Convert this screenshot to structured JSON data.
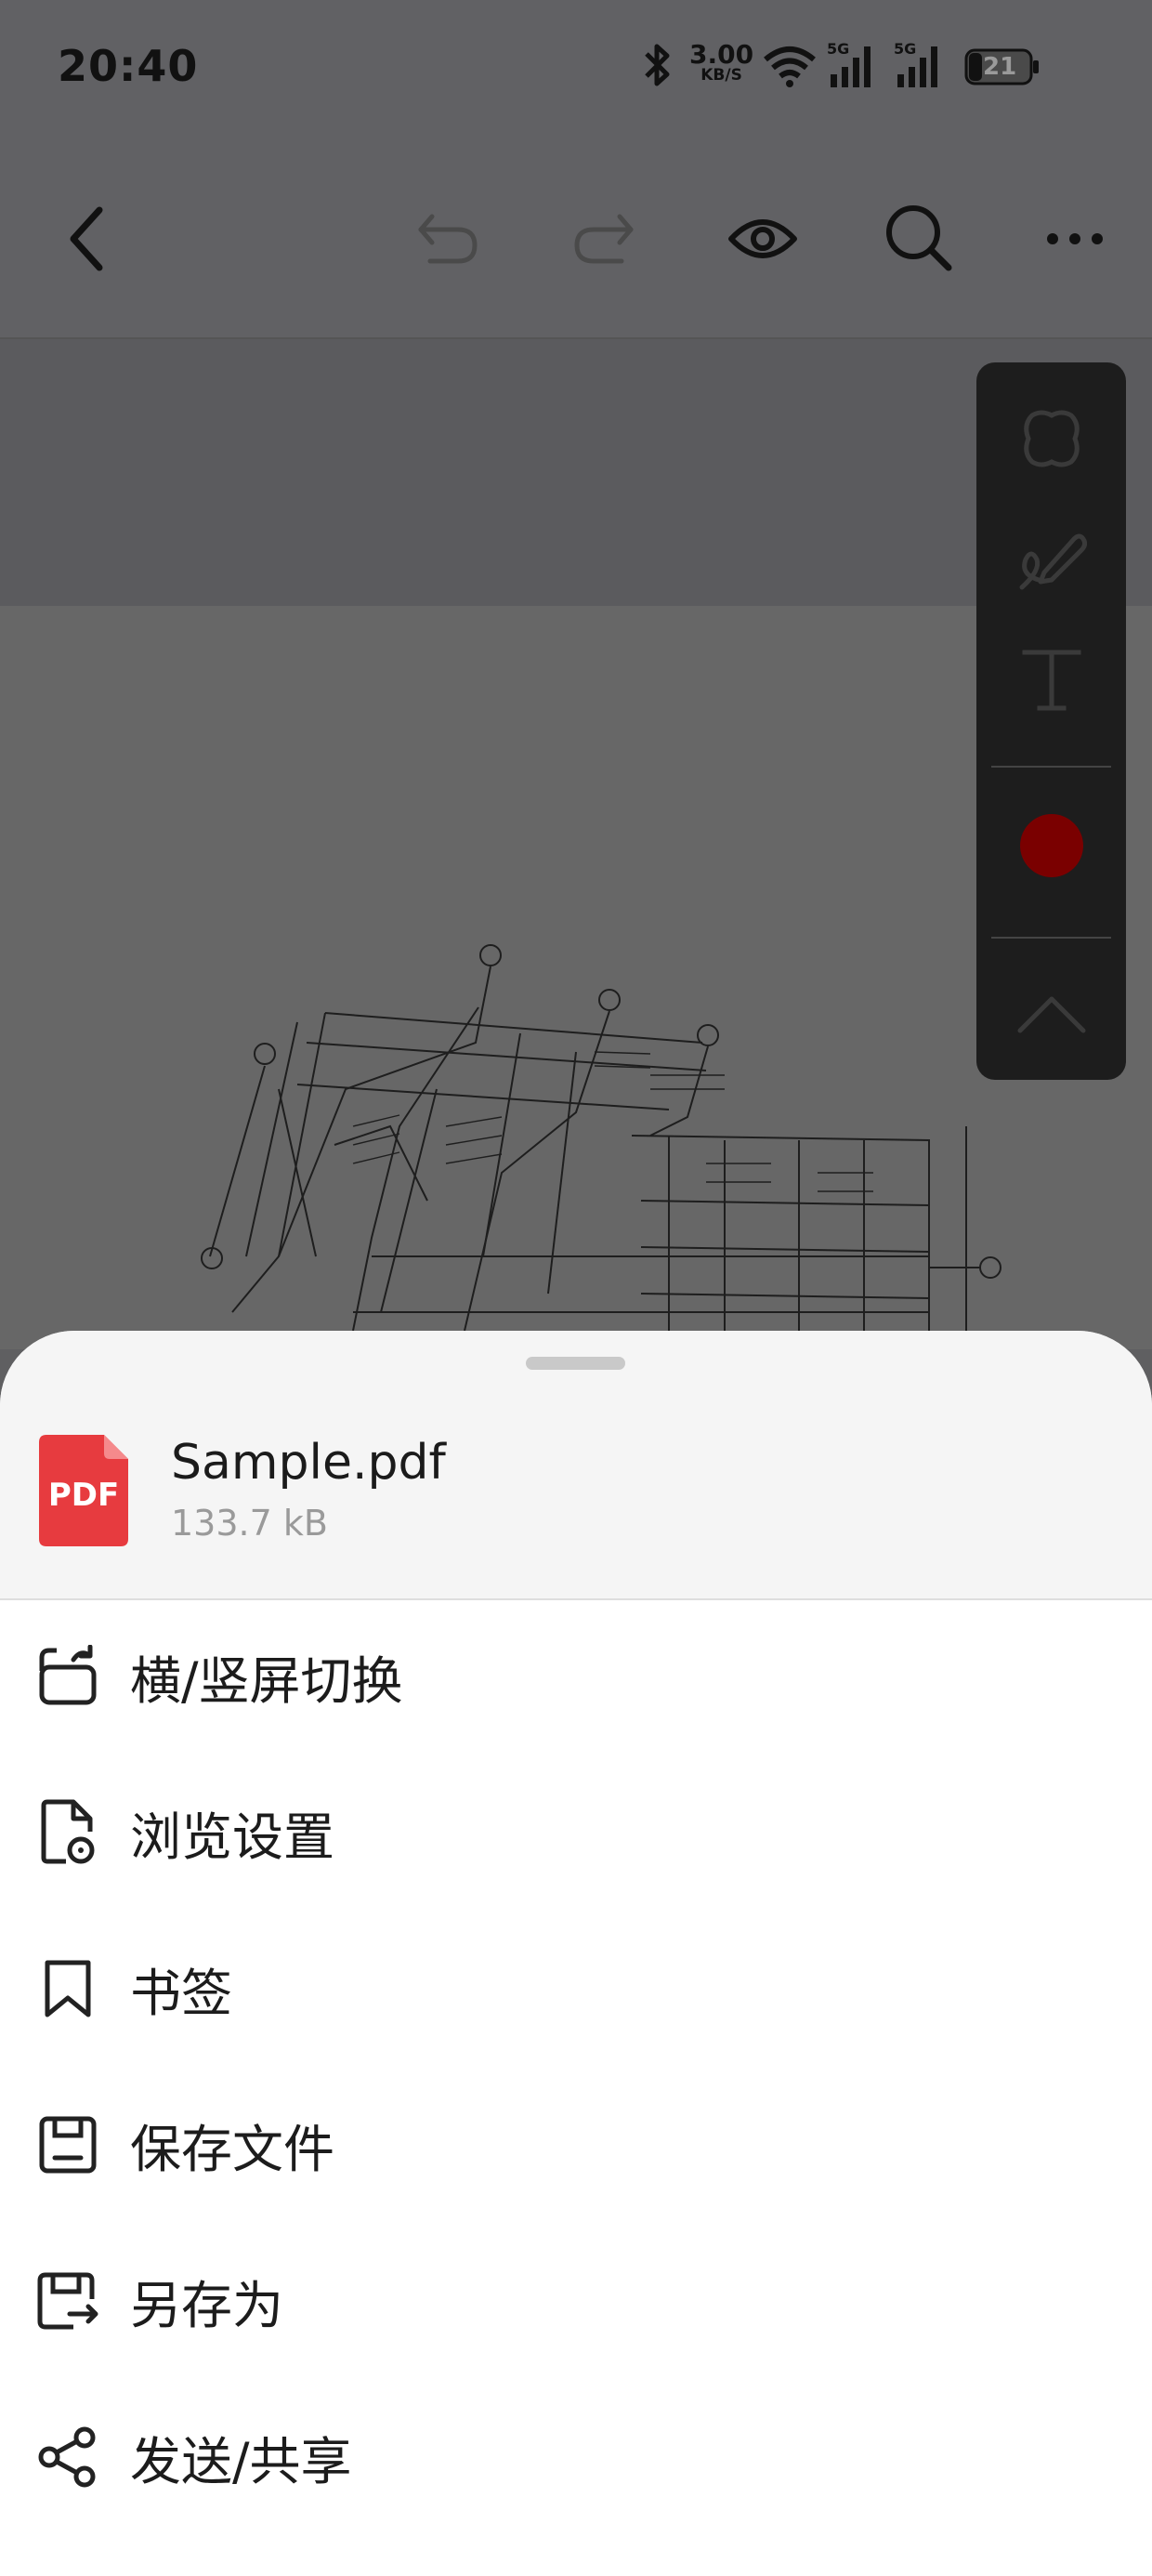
{
  "status_bar": {
    "time": "20:40",
    "net_speed": "3.00",
    "net_unit": "KB/S",
    "signal1": "5G",
    "signal2": "5G",
    "battery": "21"
  },
  "toolbar": {
    "icons": [
      "back-icon",
      "undo-icon",
      "redo-icon",
      "eye-icon",
      "search-icon",
      "more-icon"
    ]
  },
  "float_tools": {
    "icons": [
      "shape-icon",
      "pen-icon",
      "text-icon",
      "color-icon",
      "collapse-icon"
    ],
    "text_glyph": "T",
    "active_color": "#7a0000"
  },
  "file": {
    "badge": "PDF",
    "name": "Sample.pdf",
    "size": "133.7 kB",
    "badge_color": "#e73b3f"
  },
  "menu": {
    "items": [
      {
        "label": "横/竖屏切换",
        "icon": "rotate-screen-icon"
      },
      {
        "label": "浏览设置",
        "icon": "view-settings-icon"
      },
      {
        "label": "书签",
        "icon": "bookmark-icon"
      },
      {
        "label": "保存文件",
        "icon": "save-icon"
      },
      {
        "label": "另存为",
        "icon": "save-as-icon"
      },
      {
        "label": "发送/共享",
        "icon": "share-icon"
      }
    ]
  }
}
